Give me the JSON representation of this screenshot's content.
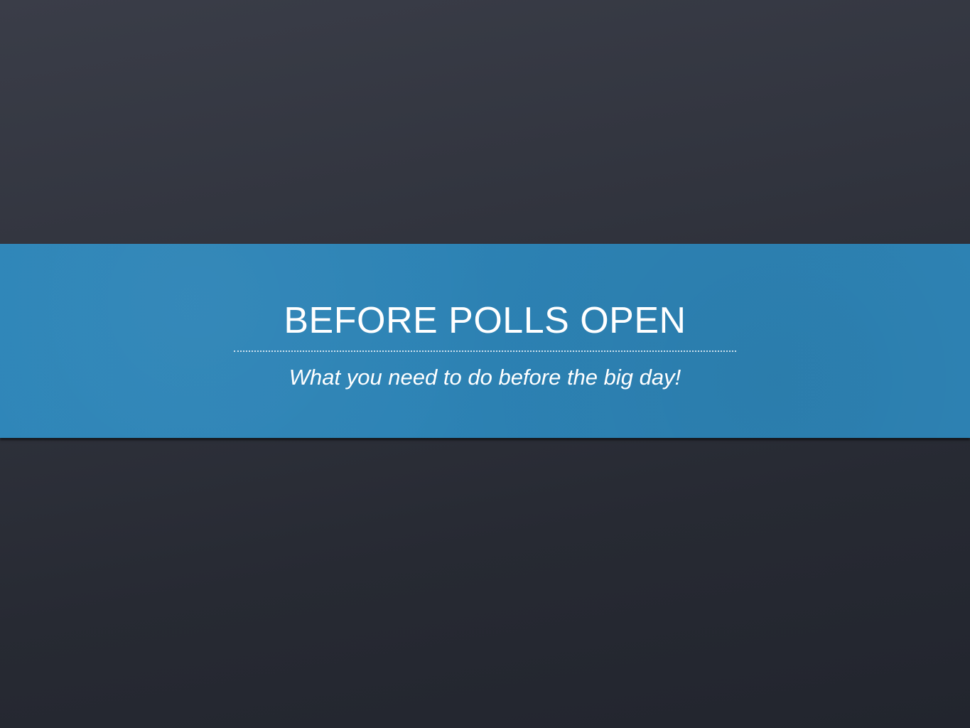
{
  "slide": {
    "title": "BEFORE POLLS OPEN",
    "subtitle": "What you need to do before the big day!"
  },
  "colors": {
    "background": "#30333d",
    "banner": "#2d84b7",
    "text": "#ffffff"
  }
}
